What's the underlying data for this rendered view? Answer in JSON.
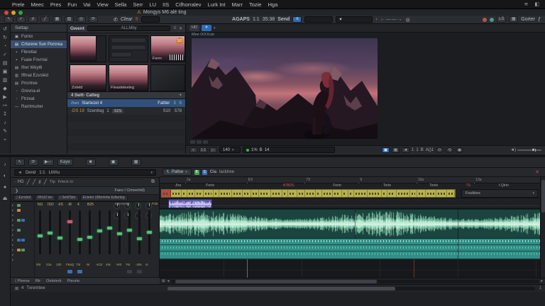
{
  "menubar": {
    "apple": "",
    "items": [
      "Prele",
      "Meec",
      "Pres",
      "Fun",
      "Vai",
      "View",
      "Sella",
      "Serr",
      "LU",
      "IIS",
      "Cifhorralev",
      "Lurk Int",
      "Marr",
      "Tozie",
      "Hga"
    ],
    "status_icons": [
      "≋",
      "◧"
    ]
  },
  "titlebar": {
    "warning": "⚠",
    "title": "Mongys M6 alé ting"
  },
  "toolbar": {
    "tool_icons": [
      "↖",
      "✓",
      "♯",
      "╱",
      "▦",
      "▧",
      "◎",
      "⟳"
    ],
    "phone_icon": "✆",
    "clear_label": "Clear",
    "clear_badge": "9",
    "display_label": "AGAPS",
    "ratio": "1:1",
    "timecode": "35:38",
    "send_label": "Send",
    "arrows": "› ←——→",
    "circle_icon": "◎",
    "right_buttons": [
      "LS",
      "▦",
      "Gorter",
      "ƒ"
    ]
  },
  "left_strip_upper": [
    "↺",
    "↻",
    "◔",
    "✓",
    "▤",
    "▣",
    "▥",
    "◆",
    "▶",
    "↦",
    "↧",
    "♪",
    "✎",
    "⌁"
  ],
  "left_strip_lower": [
    "♪",
    "◐",
    "●",
    "⏏"
  ],
  "tree": {
    "header": "Settap",
    "items": [
      {
        "icon": "▣",
        "label": "Fomix",
        "selected": false
      },
      {
        "icon": "▤",
        "label": "Crtsrene Sun Porcrea",
        "selected": true
      },
      {
        "icon": "▪",
        "label": "Fibrettai",
        "selected": false
      },
      {
        "icon": "▪",
        "label": "Fuaie Fnvrriai",
        "selected": false
      },
      {
        "icon": "▤",
        "label": "Ifrer Wéyt6",
        "selected": false
      },
      {
        "icon": "▥",
        "label": "Iffmat Ezvstéd",
        "selected": false
      },
      {
        "icon": "▤",
        "label": "Pncrtree",
        "selected": false
      },
      {
        "icon": "◦",
        "label": "Grevna-el",
        "selected": false
      },
      {
        "icon": "◦",
        "label": "Ftrzeat",
        "selected": false
      },
      {
        "icon": "—",
        "label": "Rarrtmurter",
        "selected": false
      }
    ]
  },
  "media": {
    "header": "Gwent",
    "search": "ALLMby",
    "badge": "SO",
    "thumb1_cap": "",
    "thumb2_cap": "Zoteld",
    "thumb3_cap": "Fleasteleeteg",
    "thumb_right_cap": "Ferm",
    "section_title": "4 Swtt- Catteg",
    "section_add": "+",
    "row1": {
      "chip": "Ztwrt",
      "name": "Startezet 4",
      "right_label": "Fattler",
      "n1": "3",
      "n2": "6"
    },
    "row2": {
      "id": "-DS 19",
      "name": "Szentteg",
      "n": "1",
      "pill": "S2S",
      "v1": "S10",
      "v2": "S78"
    }
  },
  "preview": {
    "tab1": "HD",
    "tab2": "✈",
    "caption": "Mee IXXXcte",
    "transport_left": [
      "⌕",
      "1:1",
      "▷"
    ],
    "zoom_value": "140",
    "status_pct": "1%",
    "status_b": "B",
    "status_n": "14",
    "right_icons": [
      "▣",
      "▦",
      "◄"
    ],
    "counters": [
      "1",
      "1",
      "B",
      "A()1"
    ],
    "round_icons": [
      "⟳",
      "⟲",
      "◉"
    ],
    "vol_icon": "◄)"
  },
  "lower_toolbar": {
    "icons": [
      "↖",
      "⟳",
      "▶─"
    ],
    "play_label": "Kaye",
    "more_icons": [
      "■",
      "▣",
      "▦"
    ],
    "device": "Dend",
    "ratio": "1:1",
    "mode": "LMXu"
  },
  "mixer": {
    "hg": "· HG",
    "tools": [
      "╱",
      "╱",
      "♯",
      "╱",
      "♪",
      "♟",
      "〰"
    ],
    "tip": "Ttp",
    "track": "Frleck Irr",
    "loop_icon": "⧉",
    "arrow": "❯",
    "title": "Faes I Cimeetrtd)",
    "tabs": [
      "⟩ Ezrsted",
      "RhU2 les",
      "⟩ Sett/Ster",
      "Ecteter (Wterkrtw Edtarteg"
    ],
    "meter_values": [
      "NU",
      "ISO",
      "-I/S",
      "-I8",
      "4",
      "B25"
    ],
    "knob_label": "eatestearr",
    "knob_value": "F15",
    "fader_values": [
      "00r",
      "22a",
      "10b",
      "F6aQ",
      "73r",
      "-5r",
      "-K22",
      "4W",
      "-W3",
      "76r",
      "-28s",
      "4r"
    ],
    "fader_pos": [
      0.42,
      0.5,
      0.38,
      0.78,
      0.34,
      0.4,
      0.55,
      0.62,
      0.48,
      0.58,
      0.36,
      0.52
    ],
    "pink_index": 3,
    "status_items": [
      "⟨ Pteese",
      "Rtr",
      "Oeteterb",
      "Pteurte"
    ],
    "bottom_icon": "⊞",
    "bottom_n": "4",
    "bottom_label": "Txremtwe"
  },
  "timeline": {
    "tab": "Pallse",
    "tab_icon": "℄",
    "btn_g": "B",
    "btn_b": "S",
    "btn1": "Cia",
    "btn2": "lacktree",
    "close": "✕",
    "ruler_ticks": [
      {
        "label": "2a",
        "pos": 7
      },
      {
        "label": "E3",
        "pos": 23
      },
      {
        "label": "73",
        "pos": 38
      },
      {
        "label": "9",
        "pos": 52
      },
      {
        "label": "10a",
        "pos": 67
      },
      {
        "label": "13a",
        "pos": 82
      }
    ],
    "markers": [
      {
        "label": "Jtra",
        "pos": 4,
        "color": "#9aa0a7"
      },
      {
        "label": "Perte",
        "pos": 12,
        "color": "#9aa0a7"
      },
      {
        "label": "A7B2S",
        "pos": 32,
        "color": "#d05a50"
      },
      {
        "label": "Ferte",
        "pos": 45,
        "color": "#9aa0a7"
      },
      {
        "label": "Terte",
        "pos": 58,
        "color": "#9aa0a7"
      },
      {
        "label": "Tente",
        "pos": 70,
        "color": "#9aa0a7"
      },
      {
        "label": "TS",
        "pos": 79.5,
        "color": "#d05a50"
      },
      {
        "label": "I-Qtrte",
        "pos": 88,
        "color": "#9aa0a7"
      }
    ],
    "chord_cells": 32,
    "track_label": "Foukkes",
    "clip_caption": "Tg"
  }
}
